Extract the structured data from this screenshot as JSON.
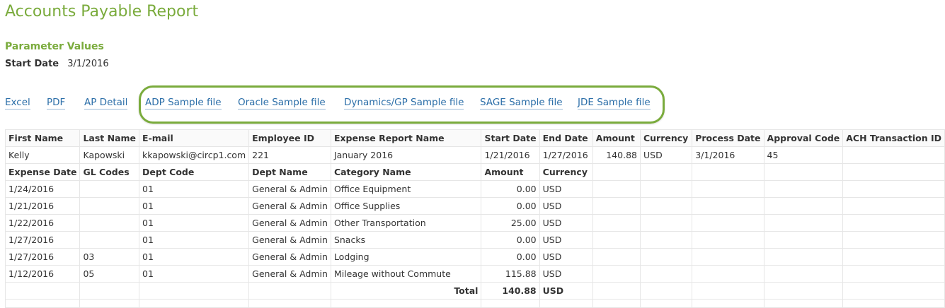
{
  "title": "Accounts Payable Report",
  "parameters": {
    "heading": "Parameter Values",
    "start_date_label": "Start Date",
    "start_date_value": "3/1/2016"
  },
  "links": {
    "excel": "Excel",
    "pdf": "PDF",
    "ap_detail": "AP Detail",
    "adp": "ADP Sample file",
    "oracle": "Oracle Sample file",
    "dynamics": "Dynamics/GP Sample file",
    "sage": "SAGE Sample file",
    "jde": "JDE Sample file"
  },
  "report": {
    "headers": [
      "First Name",
      "Last Name",
      "E-mail",
      "Employee ID",
      "Expense Report Name",
      "Start Date",
      "End Date",
      "Amount",
      "Currency",
      "Process Date",
      "Approval Code",
      "ACH Transaction ID"
    ],
    "summary": [
      "Kelly",
      "Kapowski",
      "kkapowski@circp1.com",
      "221",
      "January 2016",
      "1/21/2016",
      "1/27/2016",
      "140.88",
      "USD",
      "3/1/2016",
      "45",
      ""
    ],
    "detail_headers": [
      "Expense Date",
      "GL Codes",
      "Dept Code",
      "Dept Name",
      "Category Name",
      "Amount",
      "Currency"
    ],
    "details": [
      [
        "1/24/2016",
        "",
        "01",
        "General & Admin",
        "Office Equipment",
        "0.00",
        "USD"
      ],
      [
        "1/21/2016",
        "",
        "01",
        "General & Admin",
        "Office Supplies",
        "0.00",
        "USD"
      ],
      [
        "1/22/2016",
        "",
        "01",
        "General & Admin",
        "Other Transportation",
        "25.00",
        "USD"
      ],
      [
        "1/27/2016",
        "",
        "01",
        "General & Admin",
        "Snacks",
        "0.00",
        "USD"
      ],
      [
        "1/27/2016",
        "03",
        "01",
        "General & Admin",
        "Lodging",
        "0.00",
        "USD"
      ],
      [
        "1/12/2016",
        "05",
        "01",
        "General & Admin",
        "Mileage without Commute",
        "115.88",
        "USD"
      ]
    ],
    "total_label": "Total",
    "total_amount": "140.88",
    "total_currency": "USD"
  }
}
